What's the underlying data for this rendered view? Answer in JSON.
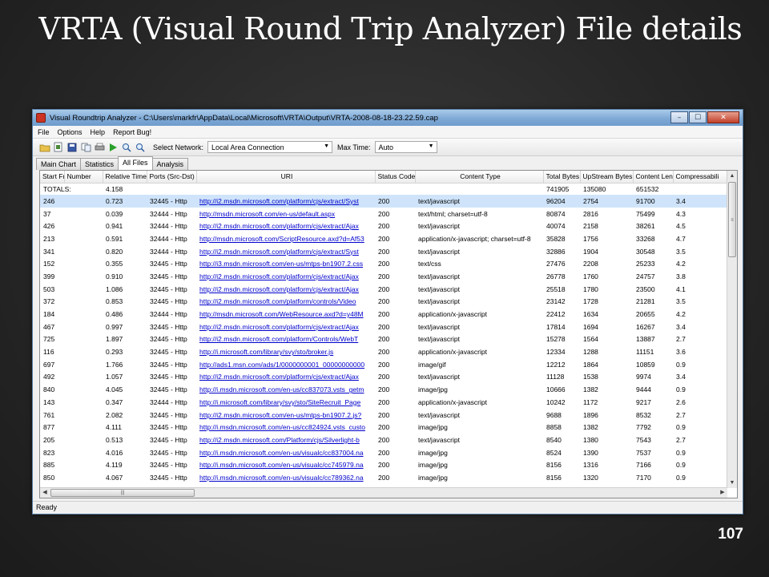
{
  "slide": {
    "title": "VRTA (Visual Round Trip Analyzer) File details",
    "page_number": "107"
  },
  "window": {
    "title": "Visual Roundtrip Analyzer - C:\\Users\\markfr\\AppData\\Local\\Microsoft\\VRTA\\Output\\VRTA-2008-08-18-23.22.59.cap",
    "minimize": "–",
    "maximize": "☐",
    "close": "✕"
  },
  "menu": [
    "File",
    "Options",
    "Help",
    "Report Bug!"
  ],
  "toolbar": {
    "network_label": "Select Network:",
    "network_value": "Local Area Connection",
    "maxtime_label": "Max Time:",
    "maxtime_value": "Auto"
  },
  "tabs": [
    "Main Chart",
    "Statistics",
    "All Files",
    "Analysis"
  ],
  "active_tab": "All Files",
  "grid": {
    "columns": [
      "Start Frame",
      "Number",
      "Relative Time",
      "Ports (Src-Dst)",
      "URI",
      "Status Code",
      "Content Type",
      "Total Bytes",
      "UpStream Bytes",
      "Content Len",
      "Compressabili"
    ],
    "totals": {
      "label": "TOTALS:",
      "relative_time": "4.158",
      "total_bytes": "741905",
      "upstream_bytes": "135080",
      "content_len": "651532"
    },
    "rows": [
      [
        "246",
        "0.723",
        "32445 - Http",
        "http://i2.msdn.microsoft.com/platform/cjs/extract/Syst",
        "200",
        "text/javascript",
        "96204",
        "2754",
        "91700",
        "3.4"
      ],
      [
        "37",
        "0.039",
        "32444 - Http",
        "http://msdn.microsoft.com/en-us/default.aspx",
        "200",
        "text/html; charset=utf-8",
        "80874",
        "2816",
        "75499",
        "4.3"
      ],
      [
        "426",
        "0.941",
        "32444 - Http",
        "http://i2.msdn.microsoft.com/platform/cjs/extract/Ajax",
        "200",
        "text/javascript",
        "40074",
        "2158",
        "38261",
        "4.5"
      ],
      [
        "213",
        "0.591",
        "32444 - Http",
        "http://msdn.microsoft.com/ScriptResource.axd?d=Af53",
        "200",
        "application/x-javascript; charset=utf-8",
        "35828",
        "1756",
        "33268",
        "4.7"
      ],
      [
        "341",
        "0.820",
        "32444 - Http",
        "http://i2.msdn.microsoft.com/platform/cjs/extract/Syst",
        "200",
        "text/javascript",
        "32886",
        "1904",
        "30548",
        "3.5"
      ],
      [
        "152",
        "0.355",
        "32445 - Http",
        "http://i3.msdn.microsoft.com/en-us/mtps-bn1907.2.css",
        "200",
        "text/css",
        "27476",
        "2208",
        "25233",
        "4.2"
      ],
      [
        "399",
        "0.910",
        "32445 - Http",
        "http://i2.msdn.microsoft.com/platform/cjs/extract/Ajax",
        "200",
        "text/javascript",
        "26778",
        "1760",
        "24757",
        "3.8"
      ],
      [
        "503",
        "1.086",
        "32445 - Http",
        "http://i2.msdn.microsoft.com/platform/cjs/extract/Ajax",
        "200",
        "text/javascript",
        "25518",
        "1780",
        "23500",
        "4.1"
      ],
      [
        "372",
        "0.853",
        "32445 - Http",
        "http://i2.msdn.microsoft.com/platform/controls/Video",
        "200",
        "text/javascript",
        "23142",
        "1728",
        "21281",
        "3.5"
      ],
      [
        "184",
        "0.486",
        "32444 - Http",
        "http://msdn.microsoft.com/WebResource.axd?d=y48M",
        "200",
        "application/x-javascript",
        "22412",
        "1634",
        "20655",
        "4.2"
      ],
      [
        "467",
        "0.997",
        "32445 - Http",
        "http://i2.msdn.microsoft.com/platform/cjs/extract/Ajax",
        "200",
        "text/javascript",
        "17814",
        "1694",
        "16267",
        "3.4"
      ],
      [
        "725",
        "1.897",
        "32445 - Http",
        "http://i2.msdn.microsoft.com/platform/Controls/WebT",
        "200",
        "text/javascript",
        "15278",
        "1564",
        "13887",
        "2.7"
      ],
      [
        "116",
        "0.293",
        "32445 - Http",
        "http://i.microsoft.com/library/svy/sto/broker.js",
        "200",
        "application/x-javascript",
        "12334",
        "1288",
        "11151",
        "3.6"
      ],
      [
        "697",
        "1.766",
        "32445 - Http",
        "http://ads1.msn.com/ads/1/0000000001_00000000000",
        "200",
        "image/gif",
        "12212",
        "1864",
        "10859",
        "0.9"
      ],
      [
        "492",
        "1.057",
        "32445 - Http",
        "http://i2.msdn.microsoft.com/platform/cjs/extract/Ajax",
        "200",
        "text/javascript",
        "11128",
        "1538",
        "9974",
        "3.4"
      ],
      [
        "840",
        "4.045",
        "32445 - Http",
        "http://i.msdn.microsoft.com/en-us/cc837073.vsts_getm",
        "200",
        "image/jpg",
        "10666",
        "1382",
        "9444",
        "0.9"
      ],
      [
        "143",
        "0.347",
        "32444 - Http",
        "http://i.microsoft.com/library/svy/sto/SiteRecruit_Page",
        "200",
        "application/x-javascript",
        "10242",
        "1172",
        "9217",
        "2.6"
      ],
      [
        "761",
        "2.082",
        "32445 - Http",
        "http://i2.msdn.microsoft.com/en-us/mtps-bn1907.2.js?",
        "200",
        "text/javascript",
        "9688",
        "1896",
        "8532",
        "2.7"
      ],
      [
        "877",
        "4.111",
        "32445 - Http",
        "http://i.msdn.microsoft.com/en-us/cc824924.vsts_custo",
        "200",
        "image/jpg",
        "8858",
        "1382",
        "7792",
        "0.9"
      ],
      [
        "205",
        "0.513",
        "32445 - Http",
        "http://i2.msdn.microsoft.com/Platform/cjs/Silverlight-b",
        "200",
        "text/javascript",
        "8540",
        "1380",
        "7543",
        "2.7"
      ],
      [
        "823",
        "4.016",
        "32445 - Http",
        "http://i.msdn.microsoft.com/en-us/visualc/cc837004.na",
        "200",
        "image/jpg",
        "8524",
        "1390",
        "7537",
        "0.9"
      ],
      [
        "885",
        "4.119",
        "32445 - Http",
        "http://i.msdn.microsoft.com/en-us/visualc/cc745979.na",
        "200",
        "image/jpg",
        "8156",
        "1316",
        "7166",
        "0.9"
      ],
      [
        "850",
        "4.067",
        "32445 - Http",
        "http://i.msdn.microsoft.com/en-us/visualc/cc789362.na",
        "200",
        "image/jpg",
        "8156",
        "1320",
        "7170",
        "0.9"
      ]
    ]
  },
  "status": "Ready",
  "icons": [
    "open-folder-icon",
    "open-file-icon",
    "save-icon",
    "copy-icon",
    "print-icon",
    "play-icon",
    "zoom-in-icon",
    "zoom-out-icon"
  ]
}
